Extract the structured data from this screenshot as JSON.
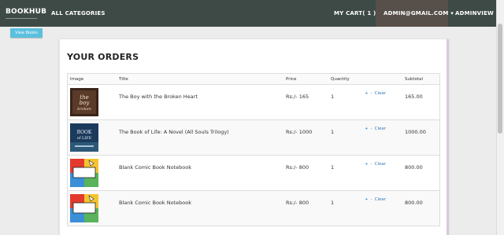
{
  "nav": {
    "brand": "BOOKHUB",
    "categories": "ALL CATEGORIES",
    "cart": "MY CART( 1 )",
    "user": "ADMIN@GMAIL.COM",
    "user_caret": "▾",
    "adminview": "ADMINVIEW"
  },
  "view_books_label": "View Books",
  "orders": {
    "title": "YOUR ORDERS",
    "headers": {
      "image": "Image",
      "title": "Title",
      "price": "Price",
      "quantity": "Quantity",
      "subtotal": "Subtotal"
    },
    "rows": [
      {
        "title": "The Boy with the Broken Heart",
        "price": "Rs:/- 165",
        "quantity": "1",
        "plus": "+",
        "minus": "-",
        "clear": "Clear",
        "subtotal": "165.00"
      },
      {
        "title": "The Book of Life: A Novel (All Souls Trilogy)",
        "price": "Rs:/- 1000",
        "quantity": "1",
        "plus": "+",
        "minus": "-",
        "clear": "Clear",
        "subtotal": "1000.00"
      },
      {
        "title": "Blank Comic Book Notebook",
        "price": "Rs:/- 800",
        "quantity": "1",
        "plus": "+",
        "minus": "-",
        "clear": "Clear",
        "subtotal": "800.00"
      },
      {
        "title": "Blank Comic Book Notebook",
        "price": "Rs:/- 800",
        "quantity": "1",
        "plus": "+",
        "minus": "-",
        "clear": "Clear",
        "subtotal": "800.00"
      }
    ]
  },
  "covers": [
    "book-cover-broken-heart",
    "book-cover-book-of-life",
    "book-cover-comic-notebook",
    "book-cover-comic-notebook"
  ]
}
